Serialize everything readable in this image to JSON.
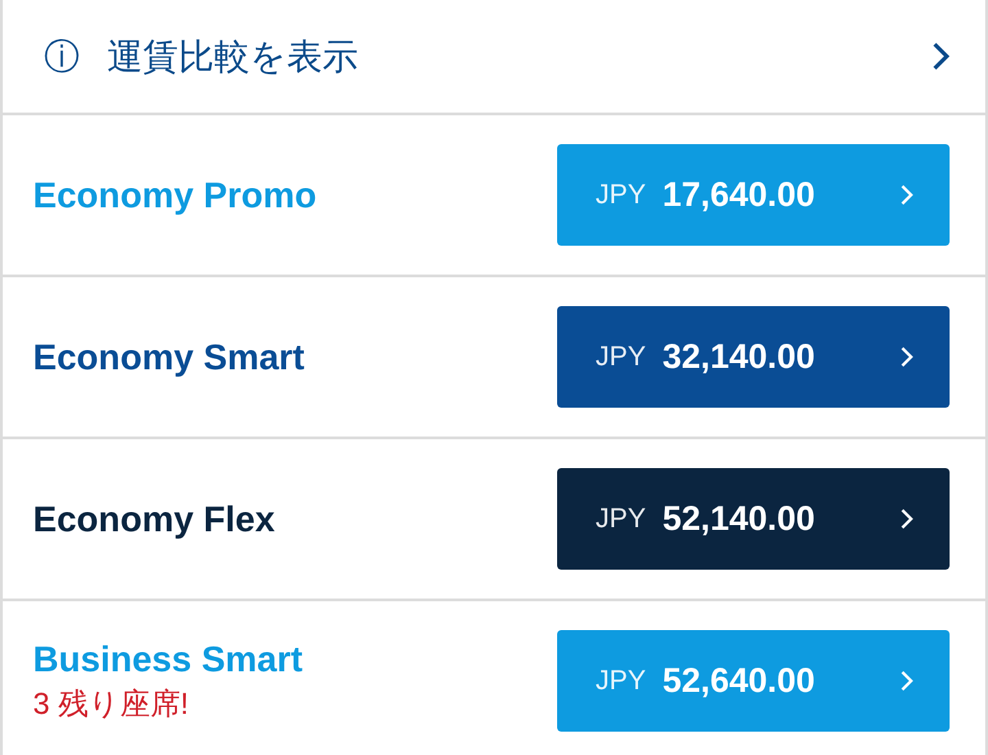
{
  "header": {
    "info_icon": "ⓘ",
    "label": "運賃比較を表示"
  },
  "fares": [
    {
      "name": "Economy Promo",
      "color": "#0e9be0",
      "currency": "JPY",
      "price": "17,640.00"
    },
    {
      "name": "Economy Smart",
      "color": "#0a4d95",
      "currency": "JPY",
      "price": "32,140.00"
    },
    {
      "name": "Economy Flex",
      "color": "#0b2540",
      "currency": "JPY",
      "price": "52,140.00"
    },
    {
      "name": "Business Smart",
      "color": "#0e9be0",
      "currency": "JPY",
      "price": "52,640.00",
      "note": "3 残り座席!"
    }
  ]
}
